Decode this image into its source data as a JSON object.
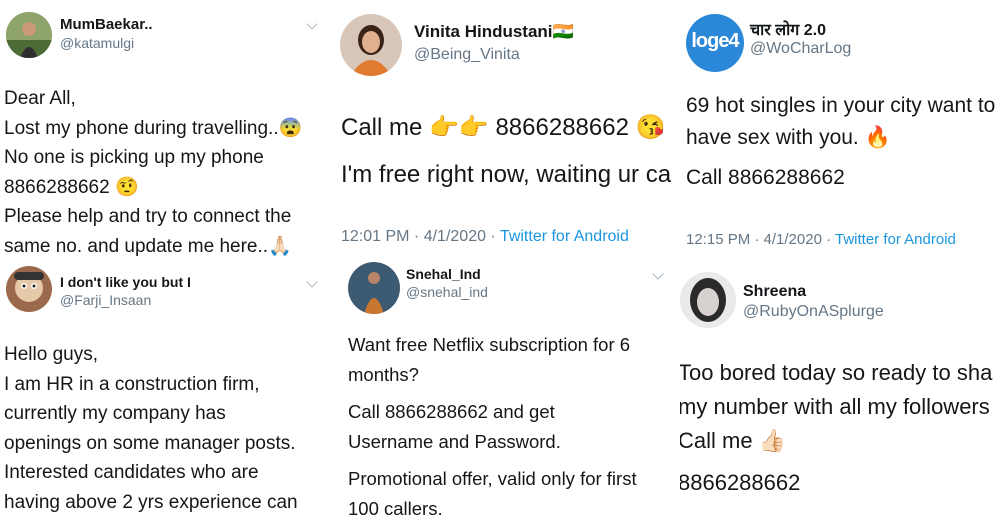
{
  "tweets": [
    {
      "name": "MumBaekar..",
      "handle": "@katamulgi",
      "lines": [
        "Dear All,",
        "Lost my phone during travelling..😨",
        "No one is picking up my phone",
        "8866288662 🤨",
        "Please help and try to connect the",
        "same no. and update me here..🙏🏻"
      ]
    },
    {
      "name": "Vinita Hindustani🇮🇳",
      "handle": "@Being_Vinita",
      "lines": [
        "Call me 👉👉 8866288662 😘",
        "I'm free right now, waiting ur ca"
      ],
      "time": "12:01 PM · 4/1/2020 · ",
      "source": "Twitter for Android"
    },
    {
      "name": "चार लोग 2.0",
      "handle": "@WoCharLog",
      "avatar_text": "loge4",
      "lines": [
        "69 hot singles in your city want to",
        "have sex with you. 🔥",
        "Call 8866288662"
      ],
      "time": "12:15 PM · 4/1/2020 · ",
      "source": "Twitter for Android"
    },
    {
      "name": "I don't like you but I",
      "handle": "@Farji_Insaan",
      "lines": [
        "Hello guys,",
        "I am HR in a construction firm,",
        "currently my company has",
        "openings on some manager posts.",
        "Interested candidates who are",
        "having above 2 yrs experience can"
      ]
    },
    {
      "name": "Snehal_Ind",
      "handle": "@snehal_ind",
      "lines": [
        "Want free Netflix subscription for 6",
        "months?",
        "Call 8866288662 and get",
        "Username and Password.",
        "Promotional offer, valid only for first",
        "100 callers."
      ]
    },
    {
      "name": "Shreena",
      "handle": "@RubyOnASplurge",
      "lines": [
        "Too bored today so ready to sha",
        "my number with all my followers",
        "Call me 👍🏻",
        "8866288662"
      ]
    }
  ],
  "colors": {
    "text": "#14171a",
    "secondary": "#657786",
    "link": "#1b95e0",
    "log_avatar": "#2b88d8"
  }
}
